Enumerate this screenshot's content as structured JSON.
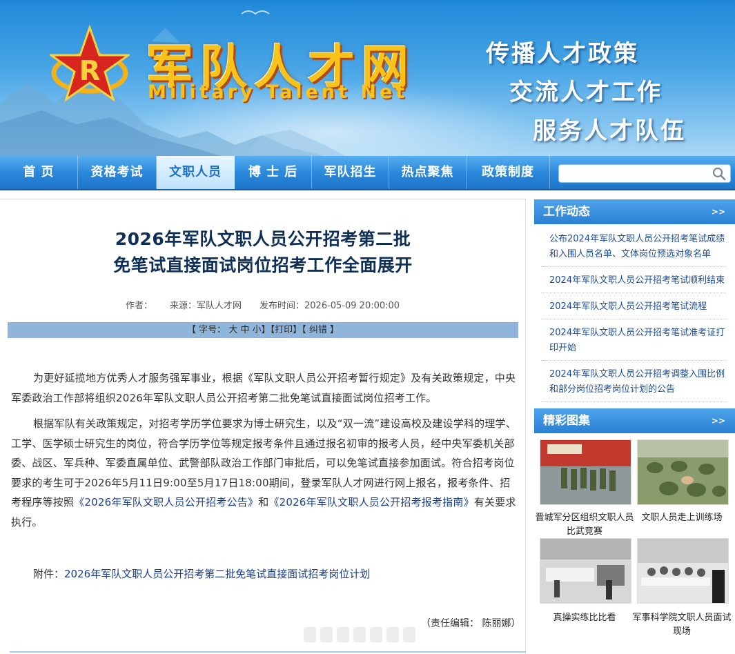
{
  "header": {
    "logo_cn": "军队人才网",
    "logo_en": "Military Talent Net",
    "slogans": [
      "传播人才政策",
      "交流人才工作",
      "服务人才队伍"
    ]
  },
  "nav": {
    "items": [
      {
        "label": "首  页"
      },
      {
        "label": "资格考试"
      },
      {
        "label": "文职人员"
      },
      {
        "label": "博 士 后"
      },
      {
        "label": "军队招生"
      },
      {
        "label": "热点聚焦"
      },
      {
        "label": "政策制度"
      }
    ],
    "active_index": 2,
    "search_value": ""
  },
  "article": {
    "title_line1": "2026年军队文职人员公开招考第二批",
    "title_line2": "免笔试直接面试岗位招考工作全面展开",
    "author_label": "作者：",
    "source": "来源：军队人才网",
    "publish_time": "发布时间：2026-05-09 20:00:00",
    "toolbar": {
      "font_size_prefix": "【 字号：",
      "size_large": "大",
      "size_medium": "中",
      "size_small": "小",
      "font_size_suffix": "】",
      "print": "【打印】",
      "report_error": "【 纠错 】"
    },
    "paragraph1": "为更好延揽地方优秀人才服务强军事业，根据《军队文职人员公开招考暂行规定》及有关政策规定，中央军委政治工作部将组织2026年军队文职人员公开招考第二批免笔试直接面试岗位招考工作。",
    "paragraph2_text": "根据军队有关政策规定，对招考学历学位要求为博士研究生，以及“双一流”建设高校及建设学科的理学、工学、医学硕士研究生的岗位，符合学历学位等规定报考条件且通过报名初审的报考人员，经中央军委机关部委、战区、军兵种、军委直属单位、武警部队政治工作部门审批后，可以免笔试直接参加面试。符合招考岗位要求的考生可于2026年5月11日9:00至5月17日18:00期间，登录军队人才网进行网上报名，报考条件、招考程序等按照",
    "paragraph2_link1": "《2026年军队文职人员公开招考公告》",
    "paragraph2_and": "和",
    "paragraph2_link2": "《2026年军队文职人员公开招考报考指南》",
    "paragraph2_tail": "有关要求执行。",
    "attachment_label": "附件：",
    "attachment_link": "2026年军队文职人员公开招考第二批免笔试直接面试招考岗位计划",
    "editor": "（责任编辑： 陈丽娜）"
  },
  "sidebar": {
    "news_title": "工作动态",
    "more_label": ">>",
    "news": [
      "公布2024年军队文职人员公开招考笔试成绩和入围人员名单、文体岗位预选对象名单",
      "2024年军队文职人员公开招考笔试顺利结束",
      "2024年军队文职人员公开招考笔试流程",
      "2024年军队文职人员公开招考笔试准考证打印开始",
      "2024年军队文职人员公开招考调整入围比例和部分岗位招考岗位计划的公告"
    ],
    "gallery_title": "精彩图集",
    "gallery": [
      {
        "caption": "晋城军分区组织文职人员比武竞赛"
      },
      {
        "caption": "文职人员走上训练场"
      },
      {
        "caption": "真操实练比比看"
      },
      {
        "caption": "军事科学院文职人员面试现场"
      }
    ]
  },
  "colors": {
    "nav_blue": "#2b88dc",
    "title_navy": "#0f2f57",
    "link_blue": "#1c4d99",
    "logo_gold": "#f7c21a",
    "toolbar_bg": "#8fb5da"
  }
}
